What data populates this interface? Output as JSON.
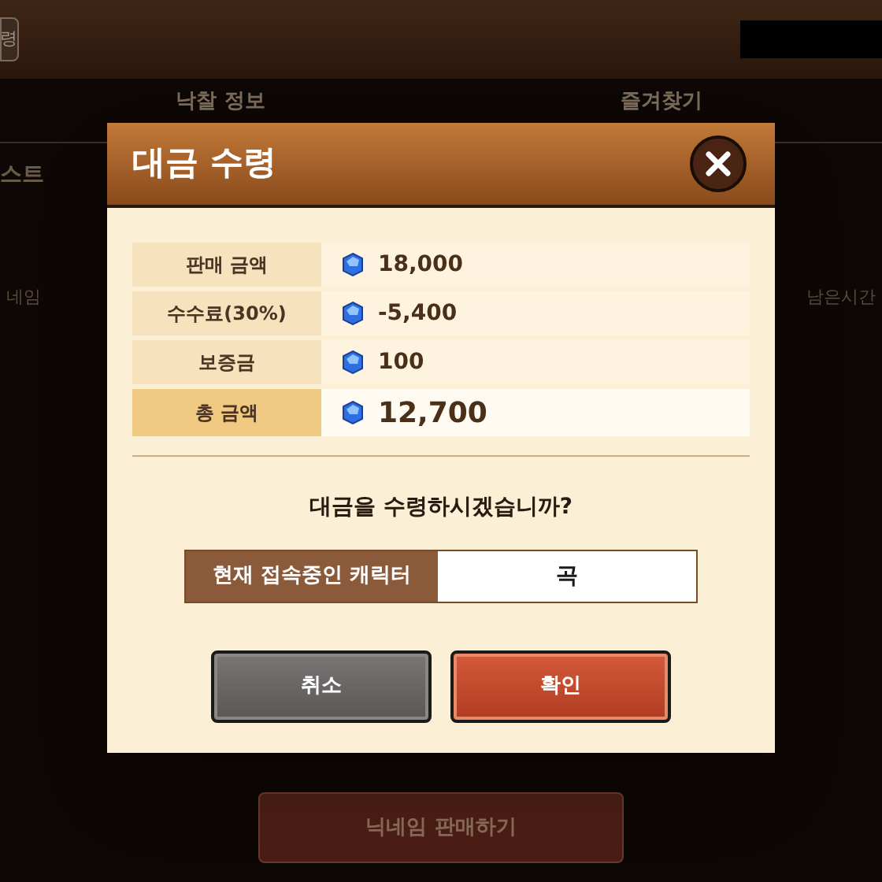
{
  "top_bar": {
    "button_label": "령"
  },
  "tabs": [
    {
      "label": "낙찰 정보"
    },
    {
      "label": "즐겨찾기"
    }
  ],
  "section_title": "스트",
  "table_header": {
    "column_1": "네임",
    "column_2": "남은시간"
  },
  "dialog": {
    "title": "대금 수령",
    "rows": [
      {
        "kind": "item",
        "label": "판매 금액",
        "value": "18,000"
      },
      {
        "kind": "item",
        "label": "수수료(30%)",
        "value": "-5,400"
      },
      {
        "kind": "item",
        "label": "보증금",
        "value": "100"
      },
      {
        "kind": "total",
        "label": "총 금액",
        "value": "12,700"
      }
    ],
    "question": "대금을 수령하시겠습니까?",
    "character": {
      "label": "현재 접속중인 캐릭터",
      "value": "곡"
    },
    "buttons": [
      {
        "kind": "cancel",
        "label": "취소"
      },
      {
        "kind": "confirm",
        "label": "확인"
      }
    ]
  },
  "sell_button": "닉네임 판매하기"
}
